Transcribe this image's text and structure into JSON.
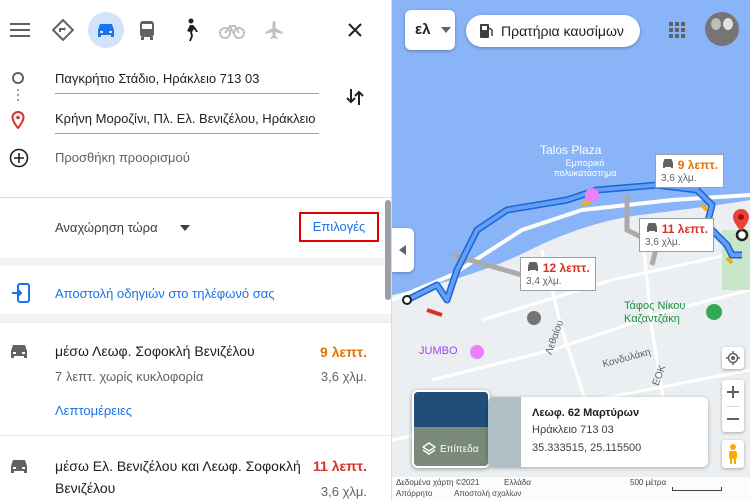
{
  "modes": {
    "menu": "menu-icon",
    "best": "directions-icon",
    "car": "car-icon",
    "transit": "bus-icon",
    "walk": "walk-icon",
    "bike": "bike-icon",
    "flight": "plane-icon",
    "close": "close-icon"
  },
  "inputs": {
    "origin": "Παγκρήτιο Στάδιο, Ηράκλειο 713 03",
    "destination": "Κρήνη Μοροζίνι, Πλ. Ελ. Βενιζέλου, Ηράκλειο",
    "add_destination": "Προσθήκη προορισμού"
  },
  "depart": {
    "label": "Αναχώρηση τώρα",
    "options": "Επιλογές"
  },
  "send": {
    "label": "Αποστολή οδηγιών στο τηλέφωνό σας"
  },
  "routes": [
    {
      "title": "μέσω Λεωφ. Σοφοκλή Βενιζέλου",
      "time": "9 λεπτ.",
      "time_color": "#e37400",
      "subtitle": "7 λεπτ. χωρίς κυκλοφορία",
      "distance": "3,6 χλμ.",
      "details": "Λεπτομέρειες"
    },
    {
      "title": "μέσω Ελ. Βενιζέλου και Λεωφ. Σοφοκλή Βενιζέλου",
      "time": "11 λεπτ.",
      "time_color": "#d93025",
      "distance": "3,6 χλμ."
    }
  ],
  "map": {
    "lang_button": "ελ",
    "fuel_chip": "Πρατήρια καυσίμων",
    "poi_talos": "Talos Plaza",
    "poi_talos_sub": "Εμπορικό πολυκατάστημα",
    "poi_tomb": "Τάφος Νίκου Καζαντζάκη",
    "poi_jumbo": "JUMBO",
    "street_lethaiou": "Λεθαίου",
    "street_kondylaki": "Κονδυλάκη",
    "street_eok": "ΕΟΚ",
    "bubbles": [
      {
        "time": "9 λεπτ.",
        "dist": "3,6 χλμ.",
        "color": "#e37400"
      },
      {
        "time": "11 λεπτ.",
        "dist": "3,6 χλμ.",
        "color": "#d93025"
      },
      {
        "time": "12 λεπτ.",
        "dist": "3,4 χλμ.",
        "color": "#d93025"
      }
    ],
    "place_card": {
      "title": "Λεωφ. 62 Μαρτύρων",
      "address": "Ηράκλειο 713 03",
      "coords": "35.333515, 25.115500"
    },
    "layers_label": "Επίπεδα",
    "footer": {
      "data": "Δεδομένα χάρτη ©2021",
      "country": "Ελλάδα",
      "terms": "Απόρρητο",
      "feedback": "Αποστολή σχολίων",
      "scale": "500 μέτρα"
    }
  },
  "colors": {
    "accent": "#1a73e8",
    "route_main": "#4285f4",
    "route_alt": "#aaaaaa",
    "orange": "#e37400",
    "red": "#d93025"
  }
}
